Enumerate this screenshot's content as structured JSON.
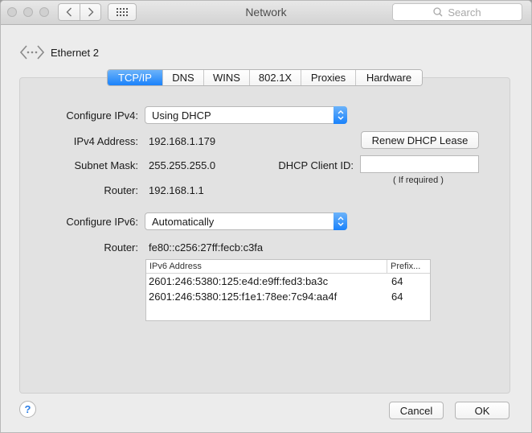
{
  "window": {
    "title": "Network"
  },
  "search": {
    "placeholder": "Search"
  },
  "interface": {
    "name": "Ethernet 2"
  },
  "tabs": [
    {
      "label": "TCP/IP",
      "active": true
    },
    {
      "label": "DNS"
    },
    {
      "label": "WINS"
    },
    {
      "label": "802.1X"
    },
    {
      "label": "Proxies"
    },
    {
      "label": "Hardware"
    }
  ],
  "ipv4": {
    "configure_label": "Configure IPv4:",
    "configure_value": "Using DHCP",
    "address_label": "IPv4 Address:",
    "address_value": "192.168.1.179",
    "subnet_label": "Subnet Mask:",
    "subnet_value": "255.255.255.0",
    "router_label": "Router:",
    "router_value": "192.168.1.1",
    "renew_button": "Renew DHCP Lease",
    "client_id_label": "DHCP Client ID:",
    "client_id_value": "",
    "client_id_note": "( If required )"
  },
  "ipv6": {
    "configure_label": "Configure IPv6:",
    "configure_value": "Automatically",
    "router_label": "Router:",
    "router_value": "fe80::c256:27ff:fecb:c3fa",
    "table": {
      "col_address": "IPv6 Address",
      "col_prefix": "Prefix...",
      "rows": [
        {
          "address": "2601:246:5380:125:e4d:e9ff:fed3:ba3c",
          "prefix": "64"
        },
        {
          "address": "2601:246:5380:125:f1e1:78ee:7c94:aa4f",
          "prefix": "64"
        }
      ]
    }
  },
  "footer": {
    "help": "?",
    "cancel": "Cancel",
    "ok": "OK"
  },
  "colors": {
    "accent": "#1a82fb"
  }
}
